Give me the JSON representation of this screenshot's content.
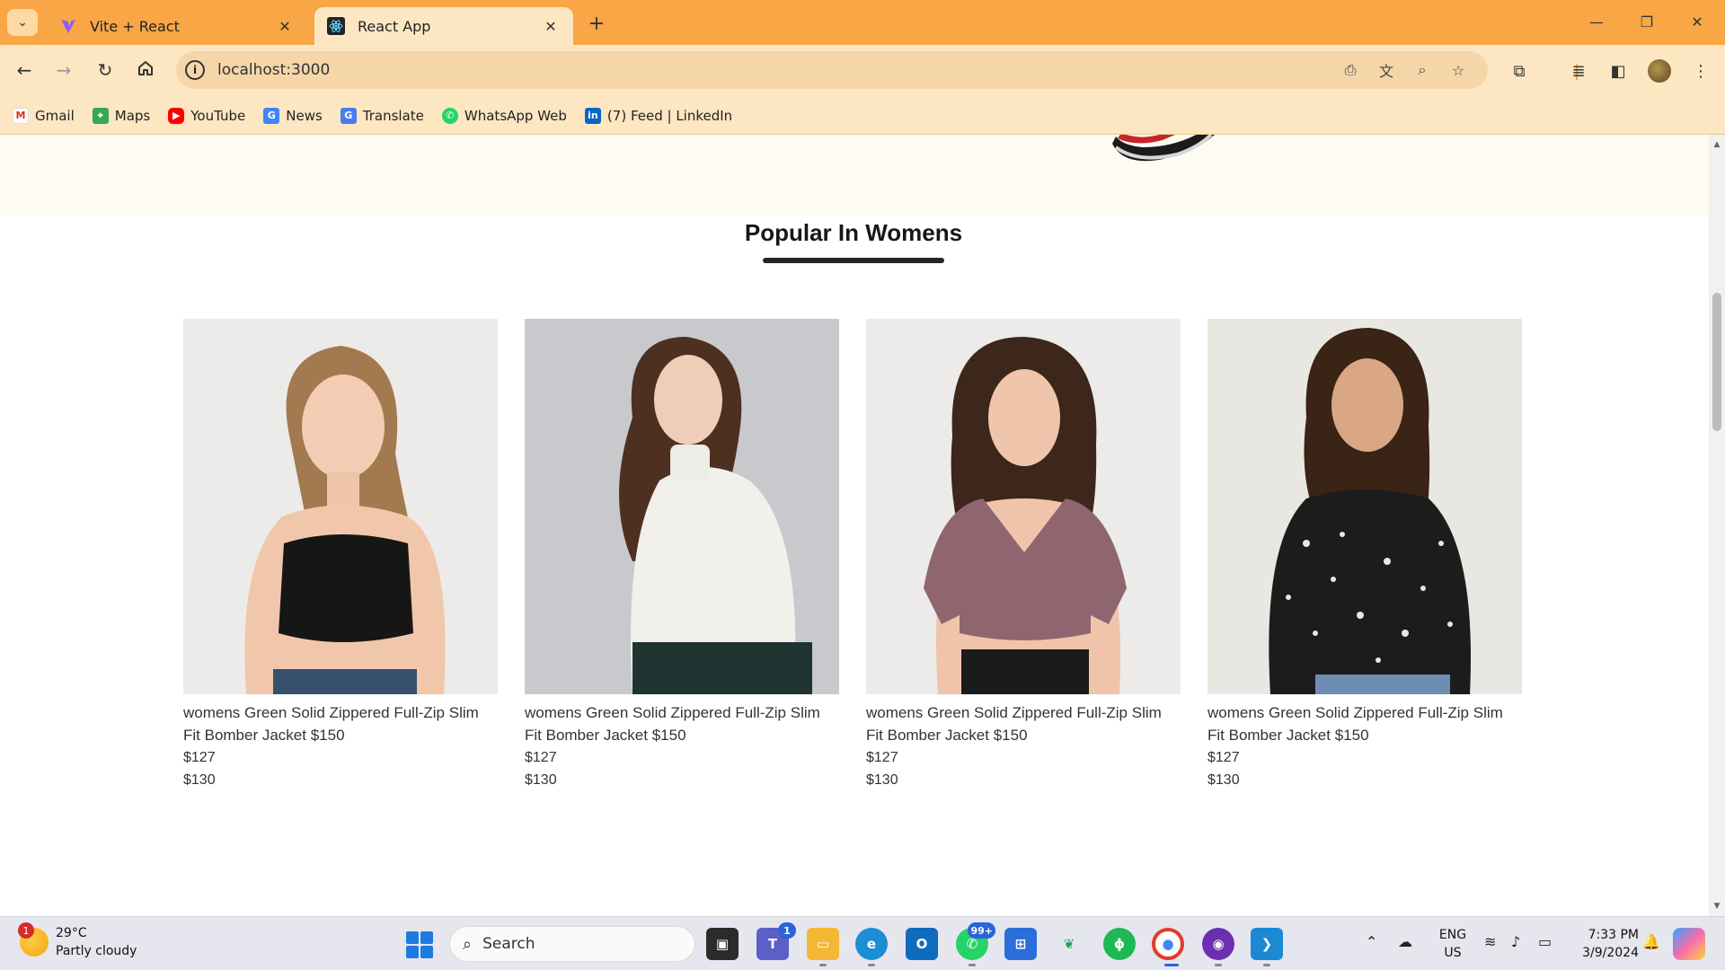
{
  "browser": {
    "tabs": [
      {
        "title": "Vite + React",
        "active": false
      },
      {
        "title": "React App",
        "active": true
      }
    ],
    "url": "localhost:3000",
    "bookmarks": [
      {
        "label": "Gmail",
        "icon": "gmail-icon"
      },
      {
        "label": "Maps",
        "icon": "maps-icon"
      },
      {
        "label": "YouTube",
        "icon": "youtube-icon"
      },
      {
        "label": "News",
        "icon": "news-icon"
      },
      {
        "label": "Translate",
        "icon": "translate-icon"
      },
      {
        "label": "WhatsApp Web",
        "icon": "whatsapp-icon"
      },
      {
        "label": "(7) Feed | LinkedIn",
        "icon": "linkedin-icon"
      }
    ],
    "accent": "#f9a646"
  },
  "page": {
    "section_title": "Popular In Womens",
    "products": [
      {
        "name": "womens Green Solid Zippered Full-Zip Slim Fit Bomber Jacket $150",
        "new_price": "$127",
        "old_price": "$130",
        "image": "model in black crop top"
      },
      {
        "name": "womens Green Solid Zippered Full-Zip Slim Fit Bomber Jacket $150",
        "new_price": "$127",
        "old_price": "$130",
        "image": "model in white turtleneck"
      },
      {
        "name": "womens Green Solid Zippered Full-Zip Slim Fit Bomber Jacket $150",
        "new_price": "$127",
        "old_price": "$130",
        "image": "model in mauve puff-sleeve top"
      },
      {
        "name": "womens Green Solid Zippered Full-Zip Slim Fit Bomber Jacket $150",
        "new_price": "$127",
        "old_price": "$130",
        "image": "model in black floral top"
      }
    ]
  },
  "taskbar": {
    "weather": {
      "temp": "29°C",
      "desc": "Partly cloudy",
      "badge": "1"
    },
    "search_label": "Search",
    "badges": {
      "teams": "1",
      "whatsapp": "99+"
    },
    "lang": {
      "line1": "ENG",
      "line2": "US"
    },
    "clock": {
      "time": "7:33 PM",
      "date": "3/9/2024"
    }
  }
}
